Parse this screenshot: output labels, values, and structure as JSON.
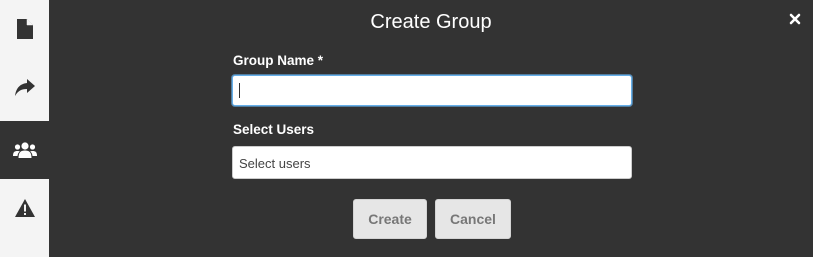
{
  "dialog": {
    "title": "Create Group",
    "group_name_label": "Group Name *",
    "group_name_value": "",
    "select_users_label": "Select Users",
    "select_users_placeholder": "Select users",
    "create_label": "Create",
    "cancel_label": "Cancel"
  },
  "sidebar": {
    "items": [
      {
        "icon": "file-icon",
        "active": false
      },
      {
        "icon": "share-icon",
        "active": false
      },
      {
        "icon": "users-icon",
        "active": true
      },
      {
        "icon": "warning-icon",
        "active": false
      }
    ]
  },
  "colors": {
    "background": "#333333",
    "sidebar": "#f4f4f4",
    "focus_border": "#66afe9",
    "button_bg": "#e6e6e6"
  }
}
